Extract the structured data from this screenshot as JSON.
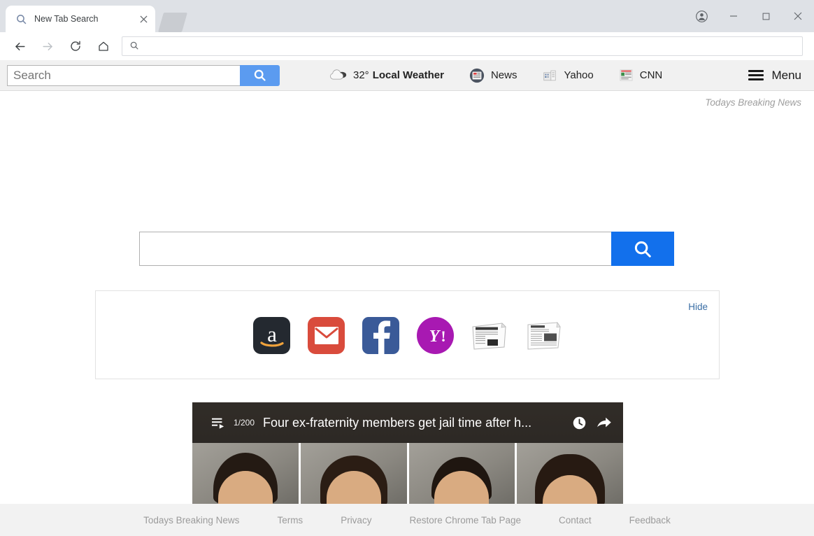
{
  "window": {
    "tab": {
      "title": "New Tab Search",
      "favicon": "search-icon",
      "close": "×"
    },
    "newtab_button": "new-tab-button",
    "controls": {
      "profile": "profile-avatar-icon",
      "minimize": "–",
      "maximize": "□",
      "close": "×"
    }
  },
  "navbar": {
    "back": "back-arrow-icon",
    "forward": "forward-arrow-icon",
    "reload": "reload-icon",
    "home": "home-icon",
    "url_value": "",
    "url_placeholder": "",
    "url_icon": "search-icon"
  },
  "ext_toolbar": {
    "search_placeholder": "Search",
    "search_value": "",
    "search_button": "search-icon",
    "weather": {
      "icon": "cloud-icon",
      "temp": "32°",
      "label": "Local Weather"
    },
    "links": [
      {
        "label": "News",
        "icon": "news-circle-icon"
      },
      {
        "label": "Yahoo",
        "icon": "building-icon"
      },
      {
        "label": "CNN",
        "icon": "cnn-article-icon"
      }
    ],
    "menu_label": "Menu",
    "menu_icon": "hamburger-icon"
  },
  "page": {
    "brand_note": "Todays Breaking News",
    "search": {
      "value": "",
      "placeholder": "",
      "button_icon": "search-icon"
    },
    "shortcuts": {
      "hide_label": "Hide",
      "tiles": [
        {
          "name": "amazon",
          "glyph": "a",
          "color": "#242930"
        },
        {
          "name": "gmail",
          "glyph": "✉",
          "color": "#d94b3c"
        },
        {
          "name": "facebook",
          "glyph": "f",
          "color": "#3a5a98"
        },
        {
          "name": "yahoo",
          "glyph": "Y!",
          "color": "#a819b2"
        },
        {
          "name": "newspaper-1",
          "glyph": "",
          "color": "#ffffff"
        },
        {
          "name": "newspaper-2",
          "glyph": "",
          "color": "#ffffff"
        }
      ]
    },
    "video": {
      "playlist_icon": "playlist-icon",
      "counter": "1/200",
      "title": "Four ex-fraternity members get jail time after h...",
      "clock_icon": "clock-icon",
      "share_icon": "share-icon"
    }
  },
  "footer": {
    "links": [
      "Todays Breaking News",
      "Terms",
      "Privacy",
      "Restore Chrome Tab Page",
      "Contact",
      "Feedback"
    ]
  },
  "colors": {
    "accent_blue": "#1270ec",
    "toolbar_blue": "#5b9bf0",
    "chrome_gray": "#dee1e6",
    "toolbar_gray": "#f1f1f1",
    "footer_gray": "#f2f2f2",
    "link_blue": "#3a6ea5"
  }
}
